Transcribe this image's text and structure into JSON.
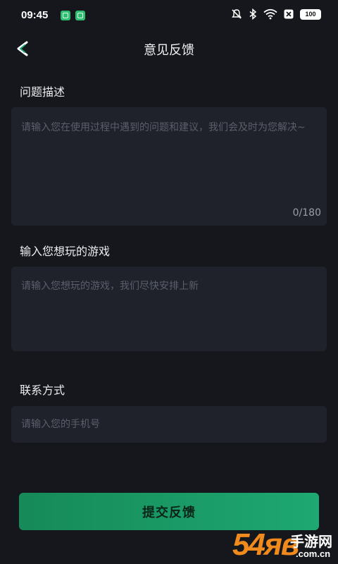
{
  "status_bar": {
    "time": "09:45",
    "battery": "100",
    "icons": [
      "app-notification-icon",
      "app-notification-icon",
      "mute-icon",
      "bluetooth-icon",
      "wifi-icon",
      "sim-off-icon",
      "battery-icon"
    ]
  },
  "header": {
    "title": "意见反馈",
    "back_icon": "back-arrow-icon"
  },
  "form": {
    "problem": {
      "label": "问题描述",
      "placeholder": "请输入您在使用过程中遇到的问题和建议，我们会及时为您解决~",
      "value": "",
      "counter": "0/180"
    },
    "game": {
      "label": "输入您想玩的游戏",
      "placeholder": "请输入您想玩的游戏，我们尽快安排上新",
      "value": ""
    },
    "contact": {
      "label": "联系方式",
      "placeholder": "请输入您的手机号",
      "value": ""
    }
  },
  "submit": {
    "label": "提交反馈"
  },
  "watermark": {
    "number": "54яв",
    "name": "手游网",
    "domain": ".com.cn"
  },
  "colors": {
    "background": "#15171c",
    "field": "#1f222b",
    "accent": "#1ea872",
    "placeholder": "#5b5f6b"
  }
}
